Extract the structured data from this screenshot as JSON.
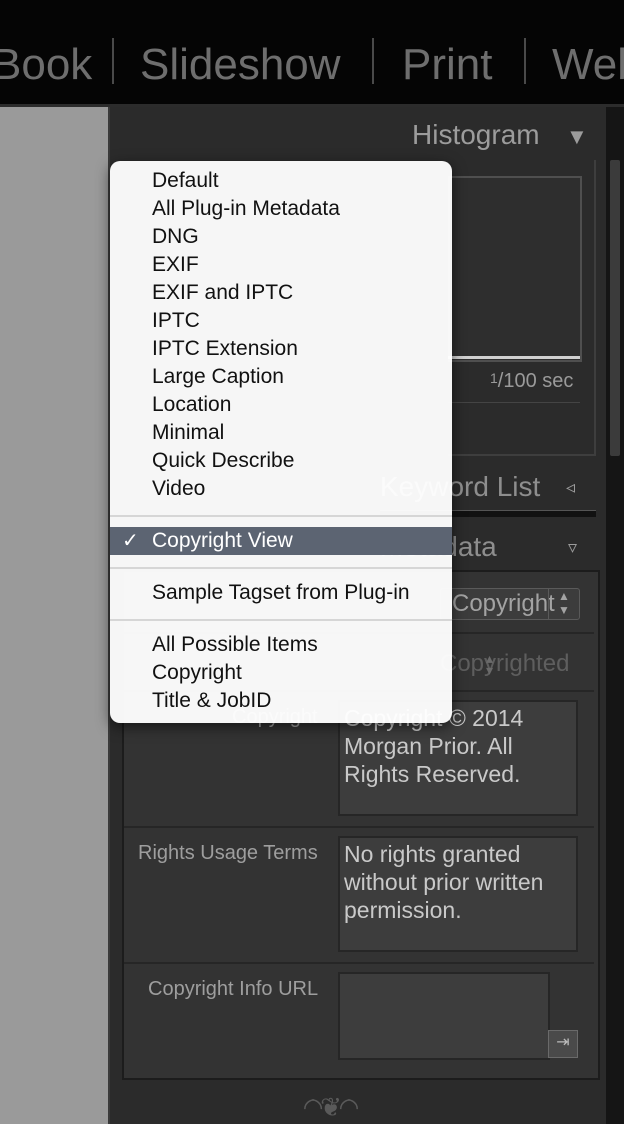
{
  "modules": [
    "Book",
    "Slideshow",
    "Print",
    "Web"
  ],
  "panels": {
    "histogram": "Histogram",
    "keyword_list": "Keyword List",
    "metadata": "Metadata",
    "shutter_speed_num": "1",
    "shutter_speed_den": "100",
    "shutter_speed_unit": "sec"
  },
  "metadata_panel": {
    "preset_select_value": "Copyright",
    "copyright_status_value": "Copyrighted",
    "fields": [
      {
        "label": "Copyright",
        "value": "Copyright © 2014\nMorgan Prior. All\nRights Reserved."
      },
      {
        "label": "Rights Usage Terms",
        "value": "No rights granted\nwithout prior written\npermission."
      },
      {
        "label": "Copyright Info URL",
        "value": ""
      }
    ]
  },
  "menu": {
    "group1": [
      "Default",
      "All Plug-in Metadata",
      "DNG",
      "EXIF",
      "EXIF and IPTC",
      "IPTC",
      "IPTC Extension",
      "Large Caption",
      "Location",
      "Minimal",
      "Quick Describe",
      "Video"
    ],
    "selected": "Copyright View",
    "checkmark": "✓",
    "group2": [
      "Sample Tagset from Plug-in"
    ],
    "group3": [
      "All Possible Items",
      "Copyright",
      "Title & JobID"
    ]
  },
  "colors": {
    "menu_highlight": "#5c6472",
    "panel_bg": "#2b2b2b",
    "topbar_bg": "#050505"
  }
}
